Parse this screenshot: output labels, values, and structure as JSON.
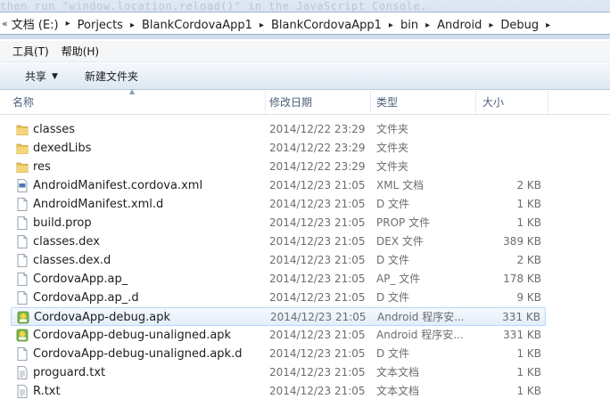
{
  "address": {
    "ghost_text": "then run \"window.location.reload()\" in the JavaScript Console.",
    "crumbs": [
      "文档 (E:)",
      "Porjects",
      "BlankCordovaApp1",
      "BlankCordovaApp1",
      "bin",
      "Android",
      "Debug"
    ]
  },
  "menu": {
    "tools": "工具(T)",
    "help": "帮助(H)"
  },
  "toolbar": {
    "share": "共享",
    "new_folder": "新建文件夹"
  },
  "columns": {
    "name": "名称",
    "date": "修改日期",
    "type": "类型",
    "size": "大小"
  },
  "files": [
    {
      "name": "classes",
      "date": "2014/12/22 23:29",
      "type": "文件夹",
      "size": "",
      "icon": "folder-icon"
    },
    {
      "name": "dexedLibs",
      "date": "2014/12/22 23:29",
      "type": "文件夹",
      "size": "",
      "icon": "folder-icon"
    },
    {
      "name": "res",
      "date": "2014/12/22 23:29",
      "type": "文件夹",
      "size": "",
      "icon": "folder-icon"
    },
    {
      "name": "AndroidManifest.cordova.xml",
      "date": "2014/12/23 21:05",
      "type": "XML 文档",
      "size": "2 KB",
      "icon": "xml-file-icon"
    },
    {
      "name": "AndroidManifest.xml.d",
      "date": "2014/12/23 21:05",
      "type": "D 文件",
      "size": "1 KB",
      "icon": "file-icon"
    },
    {
      "name": "build.prop",
      "date": "2014/12/23 21:05",
      "type": "PROP 文件",
      "size": "1 KB",
      "icon": "file-icon"
    },
    {
      "name": "classes.dex",
      "date": "2014/12/23 21:05",
      "type": "DEX 文件",
      "size": "389 KB",
      "icon": "file-icon"
    },
    {
      "name": "classes.dex.d",
      "date": "2014/12/23 21:05",
      "type": "D 文件",
      "size": "2 KB",
      "icon": "file-icon"
    },
    {
      "name": "CordovaApp.ap_",
      "date": "2014/12/23 21:05",
      "type": "AP_ 文件",
      "size": "178 KB",
      "icon": "file-icon"
    },
    {
      "name": "CordovaApp.ap_.d",
      "date": "2014/12/23 21:05",
      "type": "D 文件",
      "size": "9 KB",
      "icon": "file-icon"
    },
    {
      "name": "CordovaApp-debug.apk",
      "date": "2014/12/23 21:05",
      "type": "Android 程序安...",
      "size": "331 KB",
      "icon": "apk-icon",
      "selected": true
    },
    {
      "name": "CordovaApp-debug-unaligned.apk",
      "date": "2014/12/23 21:05",
      "type": "Android 程序安...",
      "size": "331 KB",
      "icon": "apk-icon"
    },
    {
      "name": "CordovaApp-debug-unaligned.apk.d",
      "date": "2014/12/23 21:05",
      "type": "D 文件",
      "size": "1 KB",
      "icon": "file-icon"
    },
    {
      "name": "proguard.txt",
      "date": "2014/12/23 21:05",
      "type": "文本文档",
      "size": "1 KB",
      "icon": "text-file-icon"
    },
    {
      "name": "R.txt",
      "date": "2014/12/23 21:05",
      "type": "文本文档",
      "size": "1 KB",
      "icon": "text-file-icon"
    }
  ]
}
